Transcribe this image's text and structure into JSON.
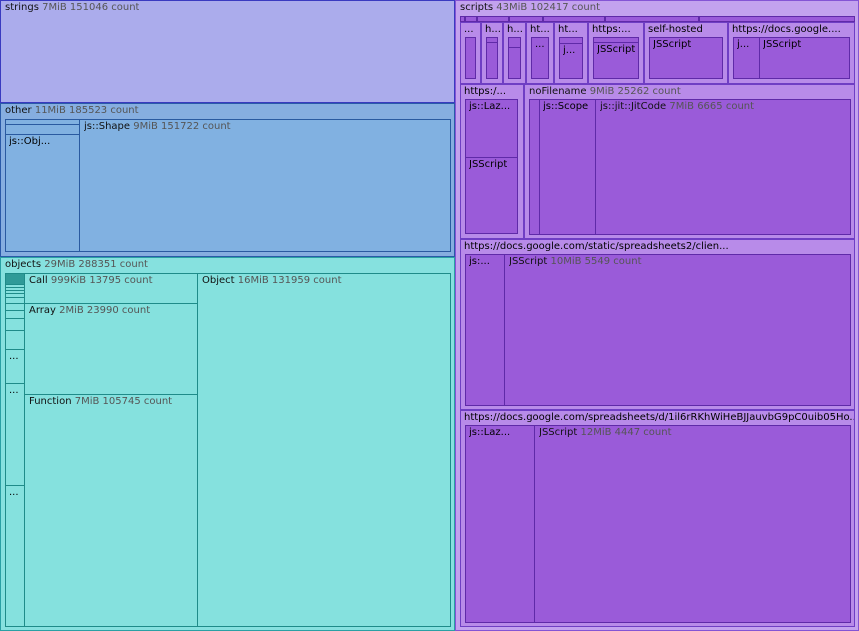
{
  "strings": {
    "name": "strings",
    "meta": "7MiB 151046 count"
  },
  "other": {
    "name": "other",
    "meta": "11MiB 185523 count",
    "obj_label": "js::Obj...",
    "shape_name": "js::Shape",
    "shape_meta": "9MiB 151722 count"
  },
  "objects": {
    "name": "objects",
    "meta": "29MiB 288351 count",
    "call_name": "Call",
    "call_meta": "999KiB 13795 count",
    "array_name": "Array",
    "array_meta": "2MiB 23990 count",
    "function_name": "Function",
    "function_meta": "7MiB 105745 count",
    "object_name": "Object",
    "object_meta": "16MiB 131959 count",
    "ellipsis": "..."
  },
  "scripts": {
    "name": "scripts",
    "meta": "43MiB 102417 count",
    "row1": {
      "c1": "...",
      "c2": "h...",
      "c3": "h...",
      "c4": "ht...",
      "c4_inner": "...",
      "c5": "ht...",
      "c5_inner": "j...",
      "c6": "https:...",
      "c6_inner": "JSScript",
      "c7": "self-hosted",
      "c7_inner": "JSScript",
      "c8": "https://docs.google....",
      "c8_inner_a": "j...",
      "c8_inner_b": "JSScript"
    },
    "row2": {
      "https": "https:/...",
      "laz": "js::Laz...",
      "jsscript": "JSScript",
      "nofile_name": "noFilename",
      "nofile_meta": "9MiB 25262 count",
      "scope": "js::Scope",
      "jit_name": "js::jit::JitCode",
      "jit_meta": "7MiB 6665 count"
    },
    "row3": {
      "title": "https://docs.google.com/static/spreadsheets2/clien...",
      "js": "js:...",
      "jss_name": "JSScript",
      "jss_meta": "10MiB 5549 count"
    },
    "row4": {
      "title": "https://docs.google.com/spreadsheets/d/1il6rRKhWiHeBJJauvbG9pC0uib05Ho...",
      "laz": "js::Laz...",
      "jss_name": "JSScript",
      "jss_meta": "12MiB 4447 count"
    }
  }
}
